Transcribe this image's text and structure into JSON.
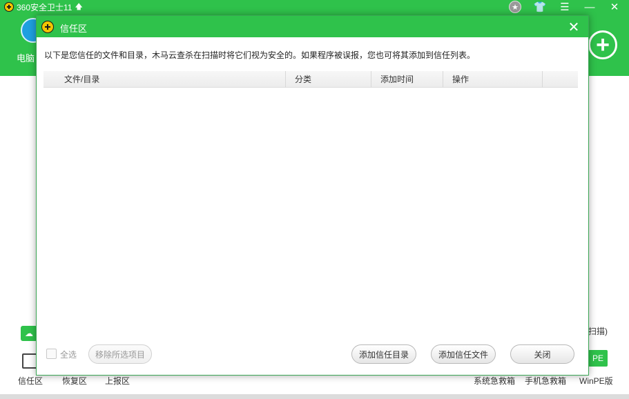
{
  "app": {
    "title": "360安全卫士11",
    "pc_label": "电脑",
    "scan_text": "扫描)",
    "pe_badge": "PE",
    "bottom_items": [
      {
        "label": "信任区"
      },
      {
        "label": "恢复区"
      },
      {
        "label": "上报区"
      },
      {
        "label": "系统急救箱"
      },
      {
        "label": "手机急救箱"
      },
      {
        "label": "WinPE版"
      }
    ]
  },
  "dialog": {
    "title": "信任区",
    "description": "以下是您信任的文件和目录，木马云查杀在扫描时将它们视为安全的。如果程序被误报，您也可将其添加到信任列表。",
    "columns": [
      {
        "label": "文件/目录"
      },
      {
        "label": "分类"
      },
      {
        "label": "添加时间"
      },
      {
        "label": "操作"
      }
    ],
    "rows": [],
    "select_all_label": "全选",
    "select_all_checked": false,
    "remove_label": "移除所选项目",
    "add_dir_label": "添加信任目录",
    "add_file_label": "添加信任文件",
    "close_label": "关闭"
  },
  "colors": {
    "brand_green": "#2fc24b"
  }
}
